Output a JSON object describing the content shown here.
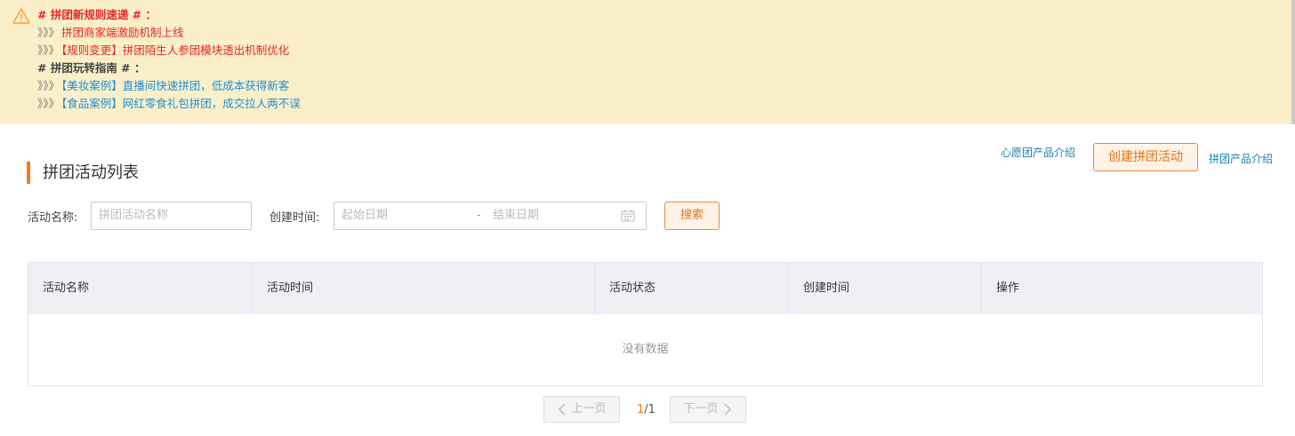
{
  "notice": {
    "heading1": "# 拼团新规则速递 # ：",
    "items1": [
      {
        "prefix": "》》》",
        "text": "拼团商家端激励机制上线"
      },
      {
        "prefix": "》》》",
        "text": "【规则变更】拼团陌生人参团模块透出机制优化"
      }
    ],
    "heading2": "# 拼团玩转指南 # ：",
    "items2": [
      {
        "prefix": "》》》",
        "text": "【美妆案例】直播间快速拼团，低成本获得新客"
      },
      {
        "prefix": "》》》",
        "text": "【食品案例】网红零食礼包拼团，成交拉人两不误"
      }
    ]
  },
  "header": {
    "wish_link": "心愿团产品介绍",
    "create_button": "创建拼团活动",
    "intro_link": "拼团产品介绍",
    "section_title": "拼团活动列表"
  },
  "filters": {
    "name_label": "活动名称:",
    "name_placeholder": "拼团活动名称",
    "time_label": "创建时间:",
    "start_placeholder": "起始日期",
    "separator": "-",
    "end_placeholder": "结束日期",
    "search_button": "搜索"
  },
  "table": {
    "columns": [
      "活动名称",
      "活动时间",
      "活动状态",
      "创建时间",
      "操作"
    ],
    "rows": [],
    "empty_text": "没有数据"
  },
  "pagination": {
    "prev_label": "上一页",
    "next_label": "下一页",
    "current": "1",
    "total": "/1"
  },
  "colors": {
    "accent": "#f47a1f",
    "notice_bg": "#faefc8",
    "link": "#1a7fb5",
    "red_text": "#e6262a",
    "blue_text": "#1e8fd6"
  }
}
